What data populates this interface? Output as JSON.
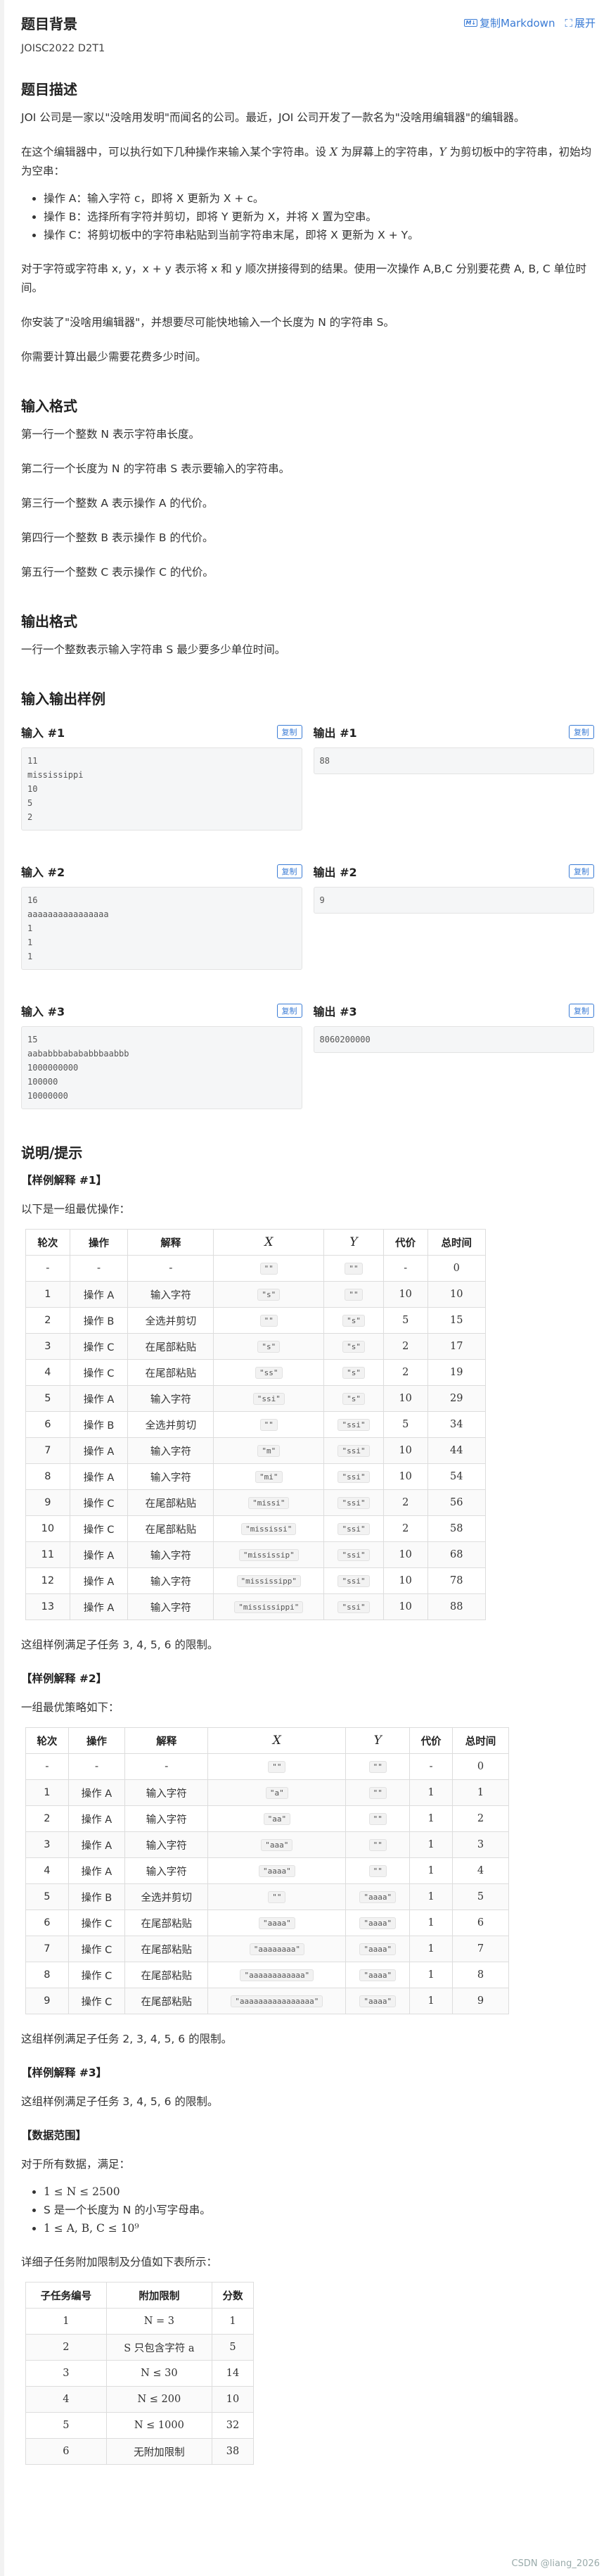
{
  "toolbar": {
    "copy_md": "复制Markdown",
    "expand": "展开"
  },
  "title": "题目背景",
  "source": "JOISC2022 D2T1",
  "h_desc": "题目描述",
  "desc1": "JOI 公司是一家以\"没啥用发明\"而闻名的公司。最近，JOI 公司开发了一款名为\"没啥用编辑器\"的编辑器。",
  "desc2a": "在这个编辑器中，可以执行如下几种操作来输入某个字符串。设",
  "desc2b": "为屏幕上的字符串，",
  "desc2c": "为剪切板中的字符串，初始均为空串：",
  "ops": [
    "操作 A：输入字符 c，即将 X 更新为 X + c。",
    "操作 B：选择所有字符并剪切，即将 Y 更新为 X，并将 X 置为空串。",
    "操作 C：将剪切板中的字符串粘贴到当前字符串末尾，即将 X 更新为 X + Y。"
  ],
  "desc3": "对于字符或字符串 x, y，x + y 表示将 x 和 y 顺次拼接得到的结果。使用一次操作 A,B,C 分别要花费 A, B, C 单位时间。",
  "desc4": "你安装了\"没啥用编辑器\"，并想要尽可能快地输入一个长度为 N 的字符串 S。",
  "desc5": "你需要计算出最少需要花费多少时间。",
  "h_input": "输入格式",
  "in": [
    "第一行一个整数 N 表示字符串长度。",
    "第二行一个长度为 N 的字符串 S 表示要输入的字符串。",
    "第三行一个整数 A 表示操作 A 的代价。",
    "第四行一个整数 B 表示操作 B 的代价。",
    "第五行一个整数 C 表示操作 C 的代价。"
  ],
  "h_output": "输出格式",
  "out": "一行一个整数表示输入字符串 S 最少要多少单位时间。",
  "h_samples": "输入输出样例",
  "copy": "复制",
  "samples": [
    {
      "in_label": "输入 #1",
      "in": "11\nmississippi\n10\n5\n2",
      "out_label": "输出 #1",
      "out": "88"
    },
    {
      "in_label": "输入 #2",
      "in": "16\naaaaaaaaaaaaaaaa\n1\n1\n1",
      "out_label": "输出 #2",
      "out": "9"
    },
    {
      "in_label": "输入 #3",
      "in": "15\naababbbabababbbaabbb\n1000000000\n100000\n10000000",
      "out_label": "输出 #3",
      "out": "8060200000"
    }
  ],
  "h_hint": "说明/提示",
  "ex1": "【样例解释 #1】",
  "ex1_sub": "以下是一组最优操作：",
  "headers": [
    "轮次",
    "操作",
    "解释",
    "X",
    "Y",
    "代价",
    "总时间"
  ],
  "t1": [
    [
      "-",
      "-",
      "-",
      "\"\"",
      "\"\"",
      "-",
      "0"
    ],
    [
      "1",
      "操作 A",
      "输入字符",
      "\"s\"",
      "\"\"",
      "10",
      "10"
    ],
    [
      "2",
      "操作 B",
      "全选并剪切",
      "\"\"",
      "\"s\"",
      "5",
      "15"
    ],
    [
      "3",
      "操作 C",
      "在尾部粘贴",
      "\"s\"",
      "\"s\"",
      "2",
      "17"
    ],
    [
      "4",
      "操作 C",
      "在尾部粘贴",
      "\"ss\"",
      "\"s\"",
      "2",
      "19"
    ],
    [
      "5",
      "操作 A",
      "输入字符",
      "\"ssi\"",
      "\"s\"",
      "10",
      "29"
    ],
    [
      "6",
      "操作 B",
      "全选并剪切",
      "\"\"",
      "\"ssi\"",
      "5",
      "34"
    ],
    [
      "7",
      "操作 A",
      "输入字符",
      "\"m\"",
      "\"ssi\"",
      "10",
      "44"
    ],
    [
      "8",
      "操作 A",
      "输入字符",
      "\"mi\"",
      "\"ssi\"",
      "10",
      "54"
    ],
    [
      "9",
      "操作 C",
      "在尾部粘贴",
      "\"missi\"",
      "\"ssi\"",
      "2",
      "56"
    ],
    [
      "10",
      "操作 C",
      "在尾部粘贴",
      "\"mississi\"",
      "\"ssi\"",
      "2",
      "58"
    ],
    [
      "11",
      "操作 A",
      "输入字符",
      "\"mississip\"",
      "\"ssi\"",
      "10",
      "68"
    ],
    [
      "12",
      "操作 A",
      "输入字符",
      "\"mississipp\"",
      "\"ssi\"",
      "10",
      "78"
    ],
    [
      "13",
      "操作 A",
      "输入字符",
      "\"mississippi\"",
      "\"ssi\"",
      "10",
      "88"
    ]
  ],
  "ex1_note": "这组样例满足子任务 3, 4, 5, 6 的限制。",
  "ex2": "【样例解释 #2】",
  "ex2_sub": "一组最优策略如下：",
  "t2": [
    [
      "-",
      "-",
      "-",
      "\"\"",
      "\"\"",
      "-",
      "0"
    ],
    [
      "1",
      "操作 A",
      "输入字符",
      "\"a\"",
      "\"\"",
      "1",
      "1"
    ],
    [
      "2",
      "操作 A",
      "输入字符",
      "\"aa\"",
      "\"\"",
      "1",
      "2"
    ],
    [
      "3",
      "操作 A",
      "输入字符",
      "\"aaa\"",
      "\"\"",
      "1",
      "3"
    ],
    [
      "4",
      "操作 A",
      "输入字符",
      "\"aaaa\"",
      "\"\"",
      "1",
      "4"
    ],
    [
      "5",
      "操作 B",
      "全选并剪切",
      "\"\"",
      "\"aaaa\"",
      "1",
      "5"
    ],
    [
      "6",
      "操作 C",
      "在尾部粘贴",
      "\"aaaa\"",
      "\"aaaa\"",
      "1",
      "6"
    ],
    [
      "7",
      "操作 C",
      "在尾部粘贴",
      "\"aaaaaaaa\"",
      "\"aaaa\"",
      "1",
      "7"
    ],
    [
      "8",
      "操作 C",
      "在尾部粘贴",
      "\"aaaaaaaaaaaa\"",
      "\"aaaa\"",
      "1",
      "8"
    ],
    [
      "9",
      "操作 C",
      "在尾部粘贴",
      "\"aaaaaaaaaaaaaaaa\"",
      "\"aaaa\"",
      "1",
      "9"
    ]
  ],
  "ex2_note": "这组样例满足子任务 2, 3, 4, 5, 6 的限制。",
  "ex3": "【样例解释 #3】",
  "ex3_note": "这组样例满足子任务 3, 4, 5, 6 的限制。",
  "range": "【数据范围】",
  "range_sub": "对于所有数据，满足：",
  "ranges": [
    "1 ≤ N ≤ 2500",
    "S 是一个长度为 N 的小写字母串。",
    "1 ≤ A, B, C ≤ 10⁹"
  ],
  "sub_intro": "详细子任务附加限制及分值如下表所示：",
  "sub_headers": [
    "子任务编号",
    "附加限制",
    "分数"
  ],
  "subtasks": [
    [
      "1",
      "N = 3",
      "1"
    ],
    [
      "2",
      "S 只包含字符 a",
      "5"
    ],
    [
      "3",
      "N ≤ 30",
      "14"
    ],
    [
      "4",
      "N ≤ 200",
      "10"
    ],
    [
      "5",
      "N ≤ 1000",
      "32"
    ],
    [
      "6",
      "无附加限制",
      "38"
    ]
  ],
  "watermark": "CSDN @liang_2026"
}
